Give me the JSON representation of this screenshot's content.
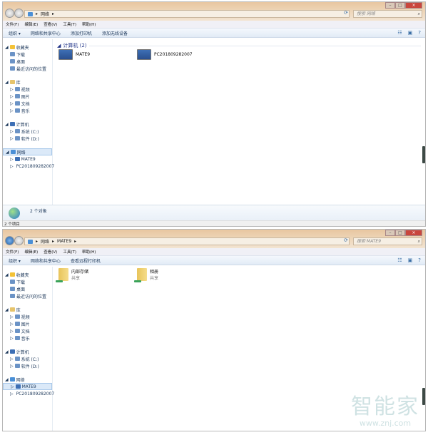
{
  "menu": [
    "文件(F)",
    "编辑(E)",
    "查看(V)",
    "工具(T)",
    "帮助(H)"
  ],
  "nav": {
    "favorites": "收藏夹",
    "fav_items": [
      "下载",
      "桌面",
      "最近访问的位置"
    ],
    "libraries": "库",
    "lib_items": [
      "视频",
      "图片",
      "文档",
      "音乐"
    ],
    "computer": "计算机",
    "comp_items": [
      "系统 (C:)",
      "软件 (D:)"
    ],
    "network": "网络",
    "net_items": [
      "MATE9",
      "PC201809282007"
    ]
  },
  "windows": [
    {
      "breadcrumb": [
        "网络"
      ],
      "search_placeholder": "搜索 网络",
      "toolbar": [
        "组织 ▾",
        "网络和共享中心",
        "添加打印机",
        "添加无线设备"
      ],
      "group_header": "计算机 (2)",
      "items": [
        {
          "name": "MATE9",
          "icon": "computer-icon"
        },
        {
          "name": "PC201809282007",
          "icon": "computer-icon"
        }
      ],
      "selected_nav": "network",
      "details_text": "2 个对象",
      "status_text": "2 个项目"
    },
    {
      "breadcrumb": [
        "网络",
        "MATE9"
      ],
      "search_placeholder": "搜索 MATE9",
      "toolbar": [
        "组织 ▾",
        "网络和共享中心",
        "查看远程打印机"
      ],
      "items": [
        {
          "name": "内部存储",
          "sub": "共享",
          "icon": "shared-folder-icon"
        },
        {
          "name": "相册",
          "sub": "共享",
          "icon": "shared-folder-icon"
        }
      ],
      "selected_nav": "MATE9"
    }
  ],
  "watermark": {
    "logo": "智能家",
    "url": "www.znj.com"
  }
}
